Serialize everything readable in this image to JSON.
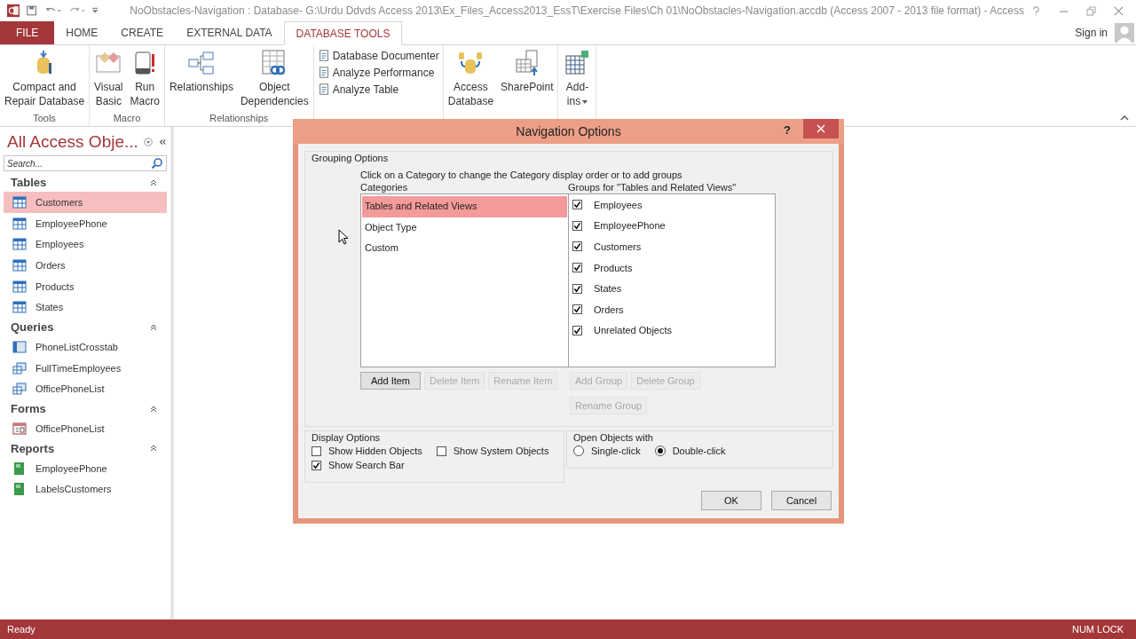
{
  "window": {
    "title": "NoObstacles-Navigation : Database- G:\\Urdu Ddvds Access 2013\\Ex_Files_Access2013_EssT\\Exercise Files\\Ch 01\\NoObstacles-Navigation.accdb (Access 2007 - 2013 file format) - Access"
  },
  "tabs": [
    {
      "label": "FILE",
      "kind": "file",
      "selected": false
    },
    {
      "label": "HOME",
      "kind": "tab",
      "selected": false
    },
    {
      "label": "CREATE",
      "kind": "tab",
      "selected": false
    },
    {
      "label": "EXTERNAL DATA",
      "kind": "tab",
      "selected": false
    },
    {
      "label": "DATABASE TOOLS",
      "kind": "tab",
      "selected": true
    }
  ],
  "account": {
    "label": "Sign in"
  },
  "ribbon": {
    "groups": [
      {
        "label": "Tools",
        "commands": [
          {
            "label": "Compact and\nRepair Database",
            "kind": "large"
          }
        ]
      },
      {
        "label": "Macro",
        "commands": [
          {
            "label": "Visual\nBasic",
            "kind": "large"
          },
          {
            "label": "Run\nMacro",
            "kind": "large"
          }
        ]
      },
      {
        "label": "Relationships",
        "commands": [
          {
            "label": "Relationships",
            "kind": "large"
          },
          {
            "label": "Object\nDependencies",
            "kind": "large"
          }
        ]
      },
      {
        "commands": [
          {
            "label": "Database Documenter",
            "kind": "small"
          },
          {
            "label": "Analyze Performance",
            "kind": "small"
          },
          {
            "label": "Analyze Table",
            "kind": "small"
          }
        ]
      },
      {
        "commands": [
          {
            "label": "Access\nDatabase",
            "kind": "large"
          },
          {
            "label": "SharePoint",
            "kind": "large"
          }
        ]
      },
      {
        "commands": [
          {
            "label": "Add-\nins",
            "kind": "dropdown"
          }
        ]
      }
    ]
  },
  "navigation_pane": {
    "title": "All Access Obje...",
    "search": {
      "placeholder": "Search..."
    },
    "groups": [
      {
        "label": "Tables",
        "items": [
          {
            "label": "Customers",
            "kind": "table",
            "selected": true
          },
          {
            "label": "EmployeePhone",
            "kind": "table",
            "selected": false
          },
          {
            "label": "Employees",
            "kind": "table",
            "selected": false
          },
          {
            "label": "Orders",
            "kind": "table",
            "selected": false
          },
          {
            "label": "Products",
            "kind": "table",
            "selected": false
          },
          {
            "label": "States",
            "kind": "table",
            "selected": false
          }
        ]
      },
      {
        "label": "Queries",
        "items": [
          {
            "label": "PhoneListCrosstab",
            "kind": "crosstab",
            "selected": false
          },
          {
            "label": "FullTimeEmployees",
            "kind": "query",
            "selected": false
          },
          {
            "label": "OfficePhoneList",
            "kind": "query",
            "selected": false
          }
        ]
      },
      {
        "label": "Forms",
        "items": [
          {
            "label": "OfficePhoneList",
            "kind": "form",
            "selected": false
          }
        ]
      },
      {
        "label": "Reports",
        "items": [
          {
            "label": "EmployeePhone",
            "kind": "report",
            "selected": false
          },
          {
            "label": "LabelsCustomers",
            "kind": "report",
            "selected": false
          }
        ]
      }
    ]
  },
  "dialog": {
    "title": "Navigation Options",
    "help": "?",
    "grouping_options": {
      "label": "Grouping Options",
      "instruction": "Click on a Category to change the Category display order or to add groups",
      "categories_label": "Categories",
      "groups_label": "Groups for \"Tables and Related Views\"",
      "categories": [
        {
          "label": "Tables and Related Views",
          "selected": true
        },
        {
          "label": "Object Type",
          "selected": false
        },
        {
          "label": "Custom",
          "selected": false
        }
      ],
      "groups": [
        {
          "label": "Employees",
          "checked": true
        },
        {
          "label": "EmployeePhone",
          "checked": true
        },
        {
          "label": "Customers",
          "checked": true
        },
        {
          "label": "Products",
          "checked": true
        },
        {
          "label": "States",
          "checked": true
        },
        {
          "label": "Orders",
          "checked": true
        },
        {
          "label": "Unrelated Objects",
          "checked": true
        }
      ],
      "category_buttons": [
        {
          "label": "Add Item",
          "disabled": false
        },
        {
          "label": "Delete Item",
          "disabled": true
        },
        {
          "label": "Rename Item",
          "disabled": true
        }
      ],
      "group_buttons": [
        {
          "label": "Add Group",
          "disabled": true
        },
        {
          "label": "Delete Group",
          "disabled": true
        },
        {
          "label": "Rename Group",
          "disabled": true
        }
      ]
    },
    "display_options": {
      "label": "Display Options",
      "options": [
        {
          "label": "Show Hidden Objects",
          "checked": false
        },
        {
          "label": "Show System Objects",
          "checked": false
        },
        {
          "label": "Show Search Bar",
          "checked": true
        }
      ]
    },
    "open_objects": {
      "label": "Open Objects with",
      "options": [
        {
          "label": "Single-click",
          "selected": false
        },
        {
          "label": "Double-click",
          "selected": true
        }
      ]
    },
    "buttons": [
      {
        "label": "OK"
      },
      {
        "label": "Cancel"
      }
    ]
  },
  "status_bar": {
    "left": "Ready",
    "right": "NUM LOCK"
  }
}
